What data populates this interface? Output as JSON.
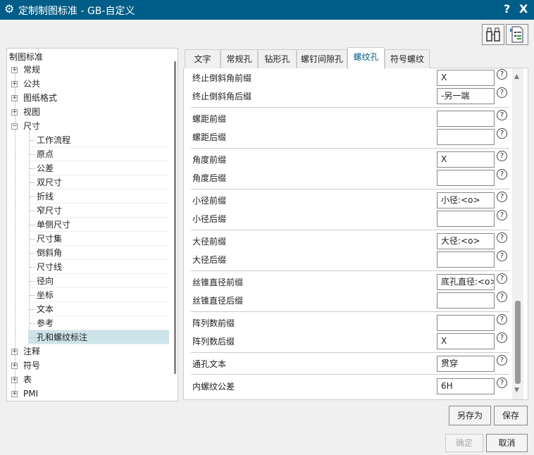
{
  "window": {
    "title": "定制制图标准 - GB-自定义",
    "help": "?",
    "close": "X"
  },
  "tree": {
    "header": "制图标准",
    "top_items": [
      {
        "label": "常规",
        "exp": "+"
      },
      {
        "label": "公共",
        "exp": "+"
      },
      {
        "label": "图纸格式",
        "exp": "+"
      },
      {
        "label": "视图",
        "exp": "+"
      },
      {
        "label": "尺寸",
        "exp": "−"
      }
    ],
    "children": [
      "工作流程",
      "原点",
      "公差",
      "双尺寸",
      "折线",
      "窄尺寸",
      "单侧尺寸",
      "尺寸集",
      "倒斜角",
      "尺寸线",
      "径向",
      "坐标",
      "文本",
      "参考",
      "孔和螺纹标注"
    ],
    "selected_child": 14,
    "bottom_items": [
      {
        "label": "注释",
        "exp": "+"
      },
      {
        "label": "符号",
        "exp": "+"
      },
      {
        "label": "表",
        "exp": "+"
      },
      {
        "label": "PMI",
        "exp": "+"
      }
    ]
  },
  "tabs": [
    "文字",
    "常规孔",
    "钻形孔",
    "螺钉间隙孔",
    "螺纹孔",
    "符号螺纹"
  ],
  "active_tab": 4,
  "rows": [
    {
      "label": "终止倒斜角前缀",
      "value": "X"
    },
    {
      "label": "终止倒斜角后缀",
      "value": "-另一端"
    },
    {
      "label": "螺距前缀",
      "value": ""
    },
    {
      "label": "螺距后缀",
      "value": ""
    },
    {
      "label": "角度前缀",
      "value": " X"
    },
    {
      "label": "角度后缀",
      "value": ""
    },
    {
      "label": "小径前缀",
      "value": "小径:<o>"
    },
    {
      "label": "小径后缀",
      "value": ""
    },
    {
      "label": "大径前缀",
      "value": "大径:<o>"
    },
    {
      "label": "大径后缀",
      "value": ""
    },
    {
      "label": "丝锥直径前缀",
      "value": "底孔直径:<o>"
    },
    {
      "label": "丝锥直径后缀",
      "value": ""
    },
    {
      "label": "阵列数前缀",
      "value": ""
    },
    {
      "label": "阵列数后缀",
      "value": " X"
    },
    {
      "label": "通孔文本",
      "value": "贯穿"
    },
    {
      "label": "内螺纹公差",
      "value": "6H"
    }
  ],
  "help_glyph": "?",
  "buttons": {
    "save_as": "另存为",
    "save": "保存",
    "ok": "确定",
    "cancel": "取消"
  }
}
